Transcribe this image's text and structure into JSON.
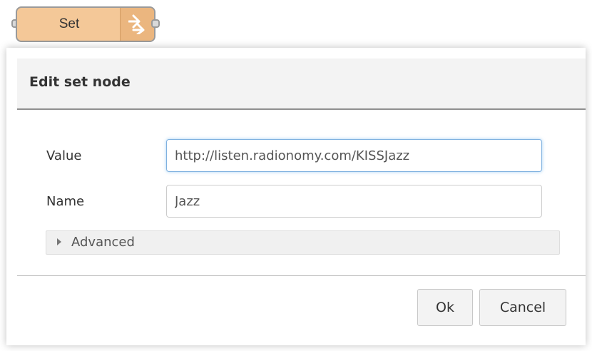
{
  "node": {
    "label": "Set",
    "icon": "arrow-in-out-icon",
    "fill_color": "#f4c898"
  },
  "dialog": {
    "title": "Edit set node",
    "fields": {
      "value": {
        "label": "Value",
        "input_value": "http://listen.radionomy.com/KISSJazz"
      },
      "name": {
        "label": "Name",
        "input_value": "Jazz"
      }
    },
    "advanced": {
      "label": "Advanced",
      "icon": "caret-right-icon"
    },
    "footer": {
      "ok_label": "Ok",
      "cancel_label": "Cancel"
    }
  },
  "colors": {
    "header_bg": "#f3f3f3",
    "focus_border": "#7fb1e0"
  }
}
